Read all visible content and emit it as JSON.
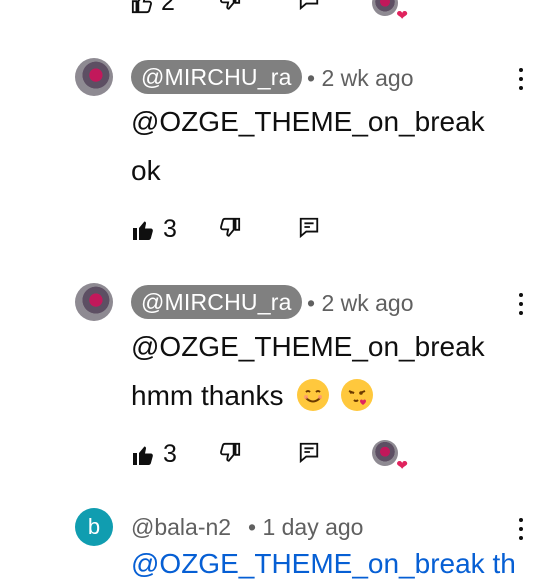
{
  "top_row": {
    "like_count": "2"
  },
  "comments": [
    {
      "handle": "@MIRCHU_ra",
      "age": "• 2 wk ago",
      "mention": "@OZGE_THEME_on_break",
      "text": "ok",
      "like_count": "3"
    },
    {
      "handle": "@MIRCHU_ra",
      "age": "• 2 wk ago",
      "mention": "@OZGE_THEME_on_break",
      "text": "hmm thanks",
      "emojis": [
        "smiling-face",
        "face-blowing-kiss"
      ],
      "like_count": "3"
    },
    {
      "avatar_letter": "b",
      "handle": "@bala-n2",
      "age": "• 1 day ago",
      "partial_text": "@OZGE_THEME_on_break th"
    }
  ],
  "colors": {
    "chip_bg": "#808080",
    "meta": "#606060",
    "link": "#065fd4",
    "avatar_b": "#109db0",
    "heart": "#e0245e"
  }
}
